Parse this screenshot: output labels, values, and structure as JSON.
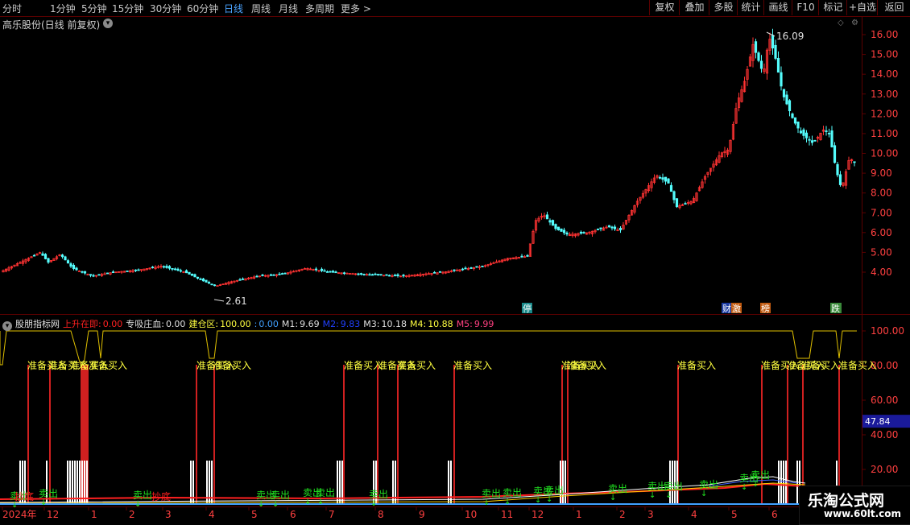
{
  "toolbar": {
    "timeframes": [
      "分时",
      "1分钟",
      "5分钟",
      "15分钟",
      "30分钟",
      "60分钟",
      "日线",
      "周线",
      "月线",
      "多周期",
      "更多 >"
    ],
    "active": "日线",
    "right_buttons": [
      "复权",
      "叠加",
      "多股",
      "统计",
      "画线",
      "F10",
      "标记",
      "+自选",
      "返回"
    ]
  },
  "main": {
    "title": "高乐股份(日线 前复权)",
    "y_axis_labels": [
      "16.00",
      "15.00",
      "14.00",
      "13.00",
      "12.00",
      "11.00",
      "10.00",
      "9.00",
      "8.00",
      "7.00",
      "6.00",
      "5.00",
      "4.00"
    ],
    "high_label": "16.09",
    "low_label": "2.61",
    "event_badges": [
      "停",
      "财",
      "激",
      "榜",
      "跌"
    ]
  },
  "indicator": {
    "name": "股朋指标网",
    "items": [
      {
        "label": "上升在即:",
        "value": "0.00",
        "color": "#ff2020"
      },
      {
        "label": "专吸庄血:",
        "value": "0.00",
        "color": "#e0e0e0"
      },
      {
        "label": "建仓区:",
        "value": "100.00",
        "color": "#ffff40"
      },
      {
        "label": ":",
        "value": "0.00",
        "color": "#40a0ff"
      },
      {
        "label": "M1:",
        "value": "9.69",
        "color": "#e0e0e0"
      },
      {
        "label": "M2:",
        "value": "9.83",
        "color": "#2040ff"
      },
      {
        "label": "M3:",
        "value": "10.18",
        "color": "#e0e0e0"
      },
      {
        "label": "M4:",
        "value": "10.88",
        "color": "#ffff40"
      },
      {
        "label": "M5:",
        "value": "9.99",
        "color": "#ff4080"
      }
    ],
    "y_axis_labels": [
      "100.00",
      "80.00",
      "60.00",
      "40.00",
      "20.00"
    ],
    "current_value": "47.84",
    "buy_label": "准备买入",
    "sell_label": "卖出",
    "bottom_label": "抄底"
  },
  "x_axis": {
    "labels": [
      "2024年",
      "12",
      "1",
      "2",
      "3",
      "4",
      "5",
      "6",
      "7",
      "8",
      "9",
      "10",
      "11",
      "12",
      "1",
      "2",
      "3",
      "4",
      "5",
      "6"
    ]
  },
  "watermark": {
    "line1": "乐淘公式网",
    "line2": "www.60lt.com"
  },
  "colors": {
    "up": "#ff3232",
    "down": "#54fcfc",
    "grid": "#5a0000",
    "axis_text": "#ff4040"
  }
}
